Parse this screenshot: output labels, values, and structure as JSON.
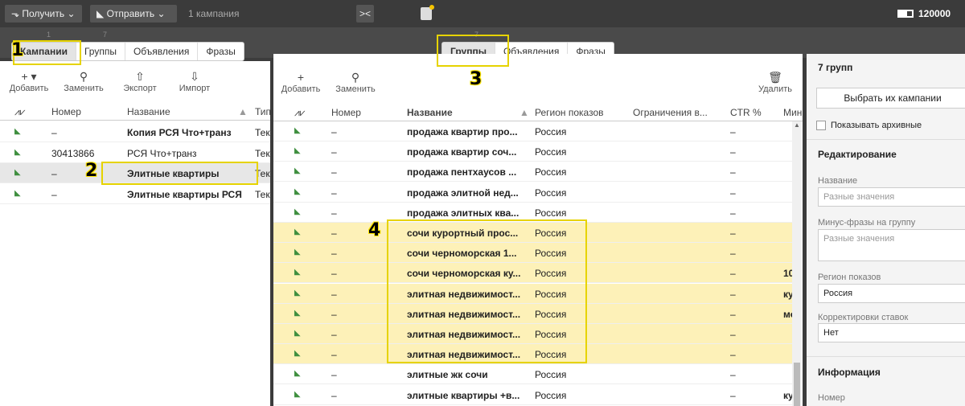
{
  "topbar": {
    "receive_label": "Получить",
    "send_label": "Отправить",
    "campaign_count": "1 кампания",
    "balance": "120000"
  },
  "left": {
    "tab_nums": [
      "1",
      "7"
    ],
    "tabs": [
      "Кампании",
      "Группы",
      "Объявления",
      "Фразы"
    ],
    "toolbar": [
      "Добавить",
      "Заменить",
      "Экспорт",
      "Импорт"
    ],
    "columns": [
      "Номер",
      "Название",
      "Тип"
    ],
    "rows": [
      {
        "num": "–",
        "name": "Копия РСЯ Что+транз",
        "type": "Тек",
        "bold": true
      },
      {
        "num": "30413866",
        "name": "РСЯ Что+транз",
        "type": "Тек",
        "bold": false
      },
      {
        "num": "–",
        "name": "Элитные квартиры",
        "type": "Тек",
        "bold": true
      },
      {
        "num": "–",
        "name": "Элитные квартиры РСЯ",
        "type": "Тек",
        "bold": true
      }
    ]
  },
  "center": {
    "tab_num": "7",
    "tabs": [
      "Группы",
      "Объявления",
      "Фразы"
    ],
    "toolbar": {
      "add": "Добавить",
      "replace": "Заменить",
      "delete": "Удалить"
    },
    "columns": [
      "Номер",
      "Название",
      "Регион показов",
      "Ограничения в...",
      "CTR %",
      "Мин"
    ],
    "rows": [
      {
        "num": "–",
        "name": "продажа квартир про...",
        "region": "Россия",
        "ctr": "–",
        "min": "",
        "hl": false
      },
      {
        "num": "–",
        "name": "продажа квартир соч...",
        "region": "Россия",
        "ctr": "–",
        "min": "",
        "hl": false
      },
      {
        "num": "–",
        "name": "продажа пентхаусов ...",
        "region": "Россия",
        "ctr": "–",
        "min": "",
        "hl": false
      },
      {
        "num": "–",
        "name": "продажа элитной нед...",
        "region": "Россия",
        "ctr": "–",
        "min": "",
        "hl": false
      },
      {
        "num": "–",
        "name": "продажа элитных ква...",
        "region": "Россия",
        "ctr": "–",
        "min": "",
        "hl": false
      },
      {
        "num": "–",
        "name": "сочи курортный прос...",
        "region": "Россия",
        "ctr": "–",
        "min": "",
        "hl": true
      },
      {
        "num": "–",
        "name": "сочи черноморская 1...",
        "region": "Россия",
        "ctr": "–",
        "min": "",
        "hl": true
      },
      {
        "num": "–",
        "name": "сочи черноморская ку...",
        "region": "Россия",
        "ctr": "–",
        "min": "10",
        "hl": true
      },
      {
        "num": "–",
        "name": "элитная недвижимост...",
        "region": "Россия",
        "ctr": "–",
        "min": "ку",
        "hl": true
      },
      {
        "num": "–",
        "name": "элитная недвижимост...",
        "region": "Россия",
        "ctr": "–",
        "min": "мо",
        "hl": true
      },
      {
        "num": "–",
        "name": "элитная недвижимост...",
        "region": "Россия",
        "ctr": "–",
        "min": "",
        "hl": true
      },
      {
        "num": "–",
        "name": "элитная недвижимост...",
        "region": "Россия",
        "ctr": "–",
        "min": "",
        "hl": true
      },
      {
        "num": "–",
        "name": "элитные жк сочи",
        "region": "Россия",
        "ctr": "–",
        "min": "",
        "hl": false
      },
      {
        "num": "–",
        "name": "элитные квартиры +в...",
        "region": "Россия",
        "ctr": "–",
        "min": "ку",
        "hl": false
      }
    ]
  },
  "right": {
    "count_title": "7 групп",
    "select_campaigns_btn": "Выбрать их кампании",
    "show_archived": "Показывать архивные",
    "edit_heading": "Редактирование",
    "name_label": "Название",
    "name_placeholder": "Разные значения",
    "minus_label": "Минус-фразы на группу",
    "minus_placeholder": "Разные значения",
    "region_label": "Регион показов",
    "region_value": "Россия",
    "bid_label": "Корректировки ставок",
    "bid_value": "Нет",
    "info_heading": "Информация",
    "number_label": "Номер"
  },
  "annotations": [
    "1",
    "2",
    "3",
    "4"
  ],
  "colors": {
    "highlight_row": "#fdf1b8",
    "annotation": "#e6d300",
    "flag_green": "#3f8f3f"
  }
}
